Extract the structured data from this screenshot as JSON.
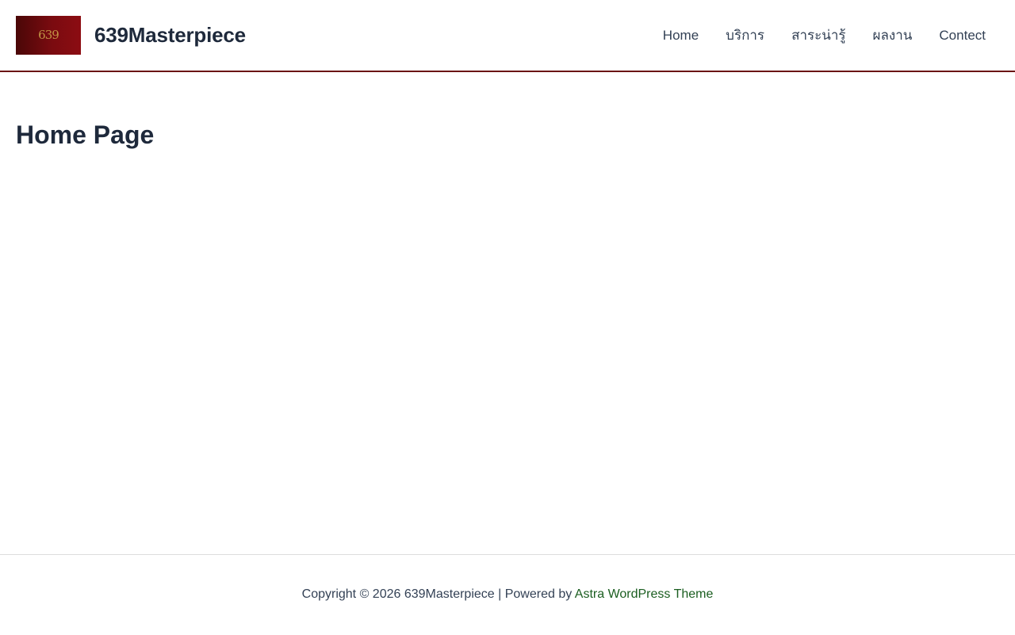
{
  "header": {
    "logo_text": "639",
    "site_title": "639Masterpiece",
    "nav": [
      {
        "label": "Home"
      },
      {
        "label": "บริการ"
      },
      {
        "label": "สาระน่ารู้"
      },
      {
        "label": "ผลงาน"
      },
      {
        "label": "Contect"
      }
    ]
  },
  "main": {
    "page_title": "Home Page"
  },
  "footer": {
    "copyright": "Copyright © 2026 639Masterpiece | Powered by",
    "powered_link": "Astra WordPress Theme"
  },
  "colors": {
    "header_border": "#6b1414",
    "logo_bg": "#7a0b10",
    "logo_mark": "#c9a24a",
    "text": "#1e293b",
    "footer_link": "#1b5e20"
  }
}
